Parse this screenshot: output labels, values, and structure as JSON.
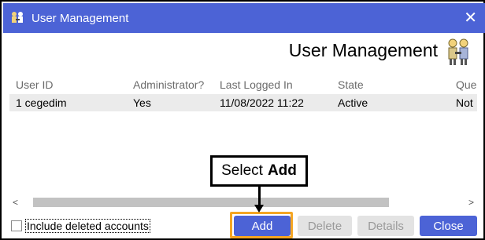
{
  "window": {
    "title": "User Management",
    "close_glyph": "✕",
    "app_icon": "users-keys-icon"
  },
  "heading": {
    "text": "User Management",
    "icon": "users-keys-icon"
  },
  "table": {
    "columns": [
      "User ID",
      "Administrator?",
      "Last Logged In",
      "State",
      "Que"
    ],
    "rows": [
      [
        "1 cegedim",
        "Yes",
        "11/08/2022 11:22",
        "Active",
        "Not"
      ]
    ]
  },
  "scrollbar": {
    "left_arrow": "<",
    "right_arrow": ">"
  },
  "footer": {
    "include_deleted_label": "Include deleted accounts",
    "include_deleted_checked": false,
    "buttons": {
      "add": "Add",
      "delete": "Delete",
      "details": "Details",
      "close": "Close"
    }
  },
  "callout": {
    "prefix": "Select",
    "emphasis": "Add"
  },
  "colors": {
    "titlebar": "#4c63d6",
    "primary_button": "#4c63d6",
    "highlight": "#f5a623",
    "disabled_button": "#e3e3e3",
    "selected_row": "#ebebeb"
  }
}
